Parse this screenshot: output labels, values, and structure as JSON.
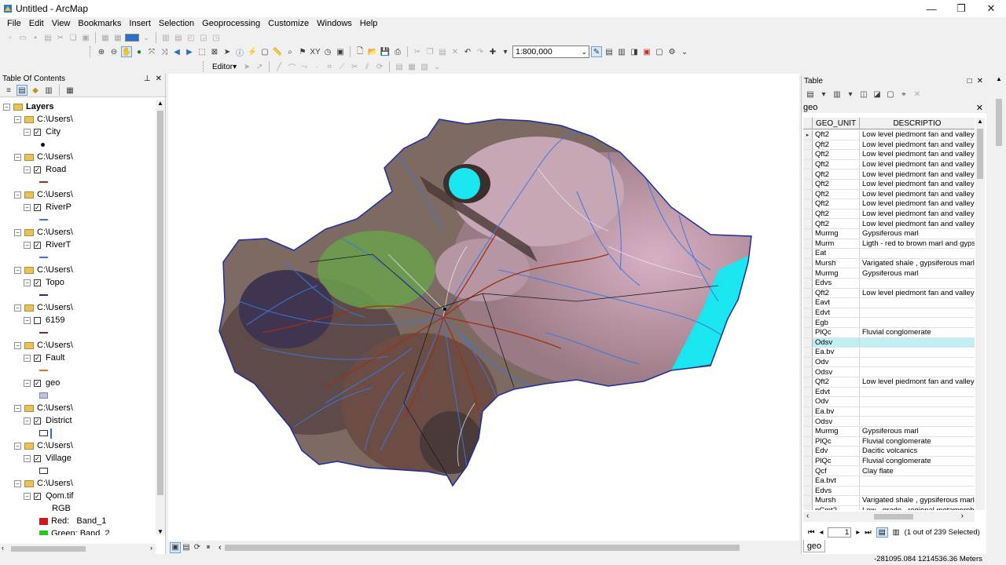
{
  "window": {
    "title": "Untitled - ArcMap",
    "controls": [
      "—",
      "❐",
      "✕"
    ]
  },
  "menu": [
    "File",
    "Edit",
    "View",
    "Bookmarks",
    "Insert",
    "Selection",
    "Geoprocessing",
    "Customize",
    "Windows",
    "Help"
  ],
  "toolbar": {
    "scale": "1:800,000",
    "editor_label": "Editor▾"
  },
  "toc": {
    "title": "Table Of Contents",
    "root": "Layers",
    "groups": [
      {
        "folder": "C:\\Users\\",
        "layer": "City",
        "checked": true
      },
      {
        "folder": "C:\\Users\\",
        "layer": "Road",
        "checked": true
      },
      {
        "folder": "C:\\Users\\",
        "layer": "RiverP",
        "checked": true
      },
      {
        "folder": "C:\\Users\\",
        "layer": "RiverT",
        "checked": true
      },
      {
        "folder": "C:\\Users\\",
        "layer": "Topo",
        "checked": true
      },
      {
        "folder": "C:\\Users\\",
        "layer": "6159",
        "checked": false
      },
      {
        "folder": "C:\\Users\\",
        "layer": "Fault",
        "checked": true
      },
      {
        "folder": "",
        "layer": "geo",
        "checked": true
      },
      {
        "folder": "C:\\Users\\",
        "layer": "District",
        "checked": true
      },
      {
        "folder": "C:\\Users\\",
        "layer": "Village",
        "checked": true
      },
      {
        "folder": "C:\\Users\\",
        "layer": "Qom.tif",
        "checked": true
      }
    ],
    "raster": {
      "rgb_label": "RGB",
      "red_label": "Red:",
      "red_band": "Band_1",
      "green_label": "Green:",
      "green_band": "Band_2"
    }
  },
  "table": {
    "window_title": "Table",
    "tab": "geo",
    "columns": [
      "GEO_UNIT",
      "DESCRIPTIO"
    ],
    "rows": [
      [
        "Qft2",
        "Low level piedmont fan and valley te"
      ],
      [
        "Qft2",
        "Low level piedmont fan and valley te"
      ],
      [
        "Qft2",
        "Low level piedmont fan and valley te"
      ],
      [
        "Qft2",
        "Low level piedmont fan and valley te"
      ],
      [
        "Qft2",
        "Low level piedmont fan and valley te"
      ],
      [
        "Qft2",
        "Low level piedmont fan and valley te"
      ],
      [
        "Qft2",
        "Low level piedmont fan and valley te"
      ],
      [
        "Qft2",
        "Low level piedmont fan and valley te"
      ],
      [
        "Qft2",
        "Low level piedmont fan and valley te"
      ],
      [
        "Qft2",
        "Low level piedmont fan and valley te"
      ],
      [
        "Murmg",
        "Gypsiferous marl"
      ],
      [
        "Murm",
        "Ligth - red to brown marl and gypsife"
      ],
      [
        "Eat",
        ""
      ],
      [
        "Mursh",
        "Varigated shale , gypsiferous marl ar"
      ],
      [
        "Murmg",
        "Gypsiferous marl"
      ],
      [
        "Edvs",
        ""
      ],
      [
        "Qft2",
        "Low level piedmont fan and valley te"
      ],
      [
        "Eavt",
        ""
      ],
      [
        "Edvt",
        ""
      ],
      [
        "Egb",
        ""
      ],
      [
        "PlQc",
        "Fluvial conglomerate"
      ],
      [
        "Odsv",
        ""
      ],
      [
        "Ea.bv",
        ""
      ],
      [
        "Odv",
        ""
      ],
      [
        "Odsv",
        ""
      ],
      [
        "Qft2",
        "Low level piedmont fan and valley te"
      ],
      [
        "Edvt",
        ""
      ],
      [
        "Odv",
        ""
      ],
      [
        "Ea.bv",
        ""
      ],
      [
        "Odsv",
        ""
      ],
      [
        "Murmg",
        "Gypsiferous marl"
      ],
      [
        "PlQc",
        "Fluvial conglomerate"
      ],
      [
        "Edv",
        "Dacitic volcanics"
      ],
      [
        "PlQc",
        "Fluvial conglomerate"
      ],
      [
        "Qcf",
        "Clay flate"
      ],
      [
        "Ea.bvt",
        ""
      ],
      [
        "Edvs",
        ""
      ],
      [
        "Mursh",
        "Varigated shale , gypsiferous marl ar"
      ],
      [
        "pCmt2",
        "Low - grade , regional metamorphic"
      ]
    ],
    "highlighted_row": 21,
    "current_record": "1",
    "selection_status": "(1 out of 239 Selected)",
    "bottom_tab": "geo"
  },
  "status": {
    "coordinates": "-281095.084  1214536.36 Meters"
  },
  "colors": {
    "highlight": "#bfeef3",
    "water": "#19e6ee",
    "river_blue": "#3a78e0",
    "road_brown": "#a03010"
  }
}
